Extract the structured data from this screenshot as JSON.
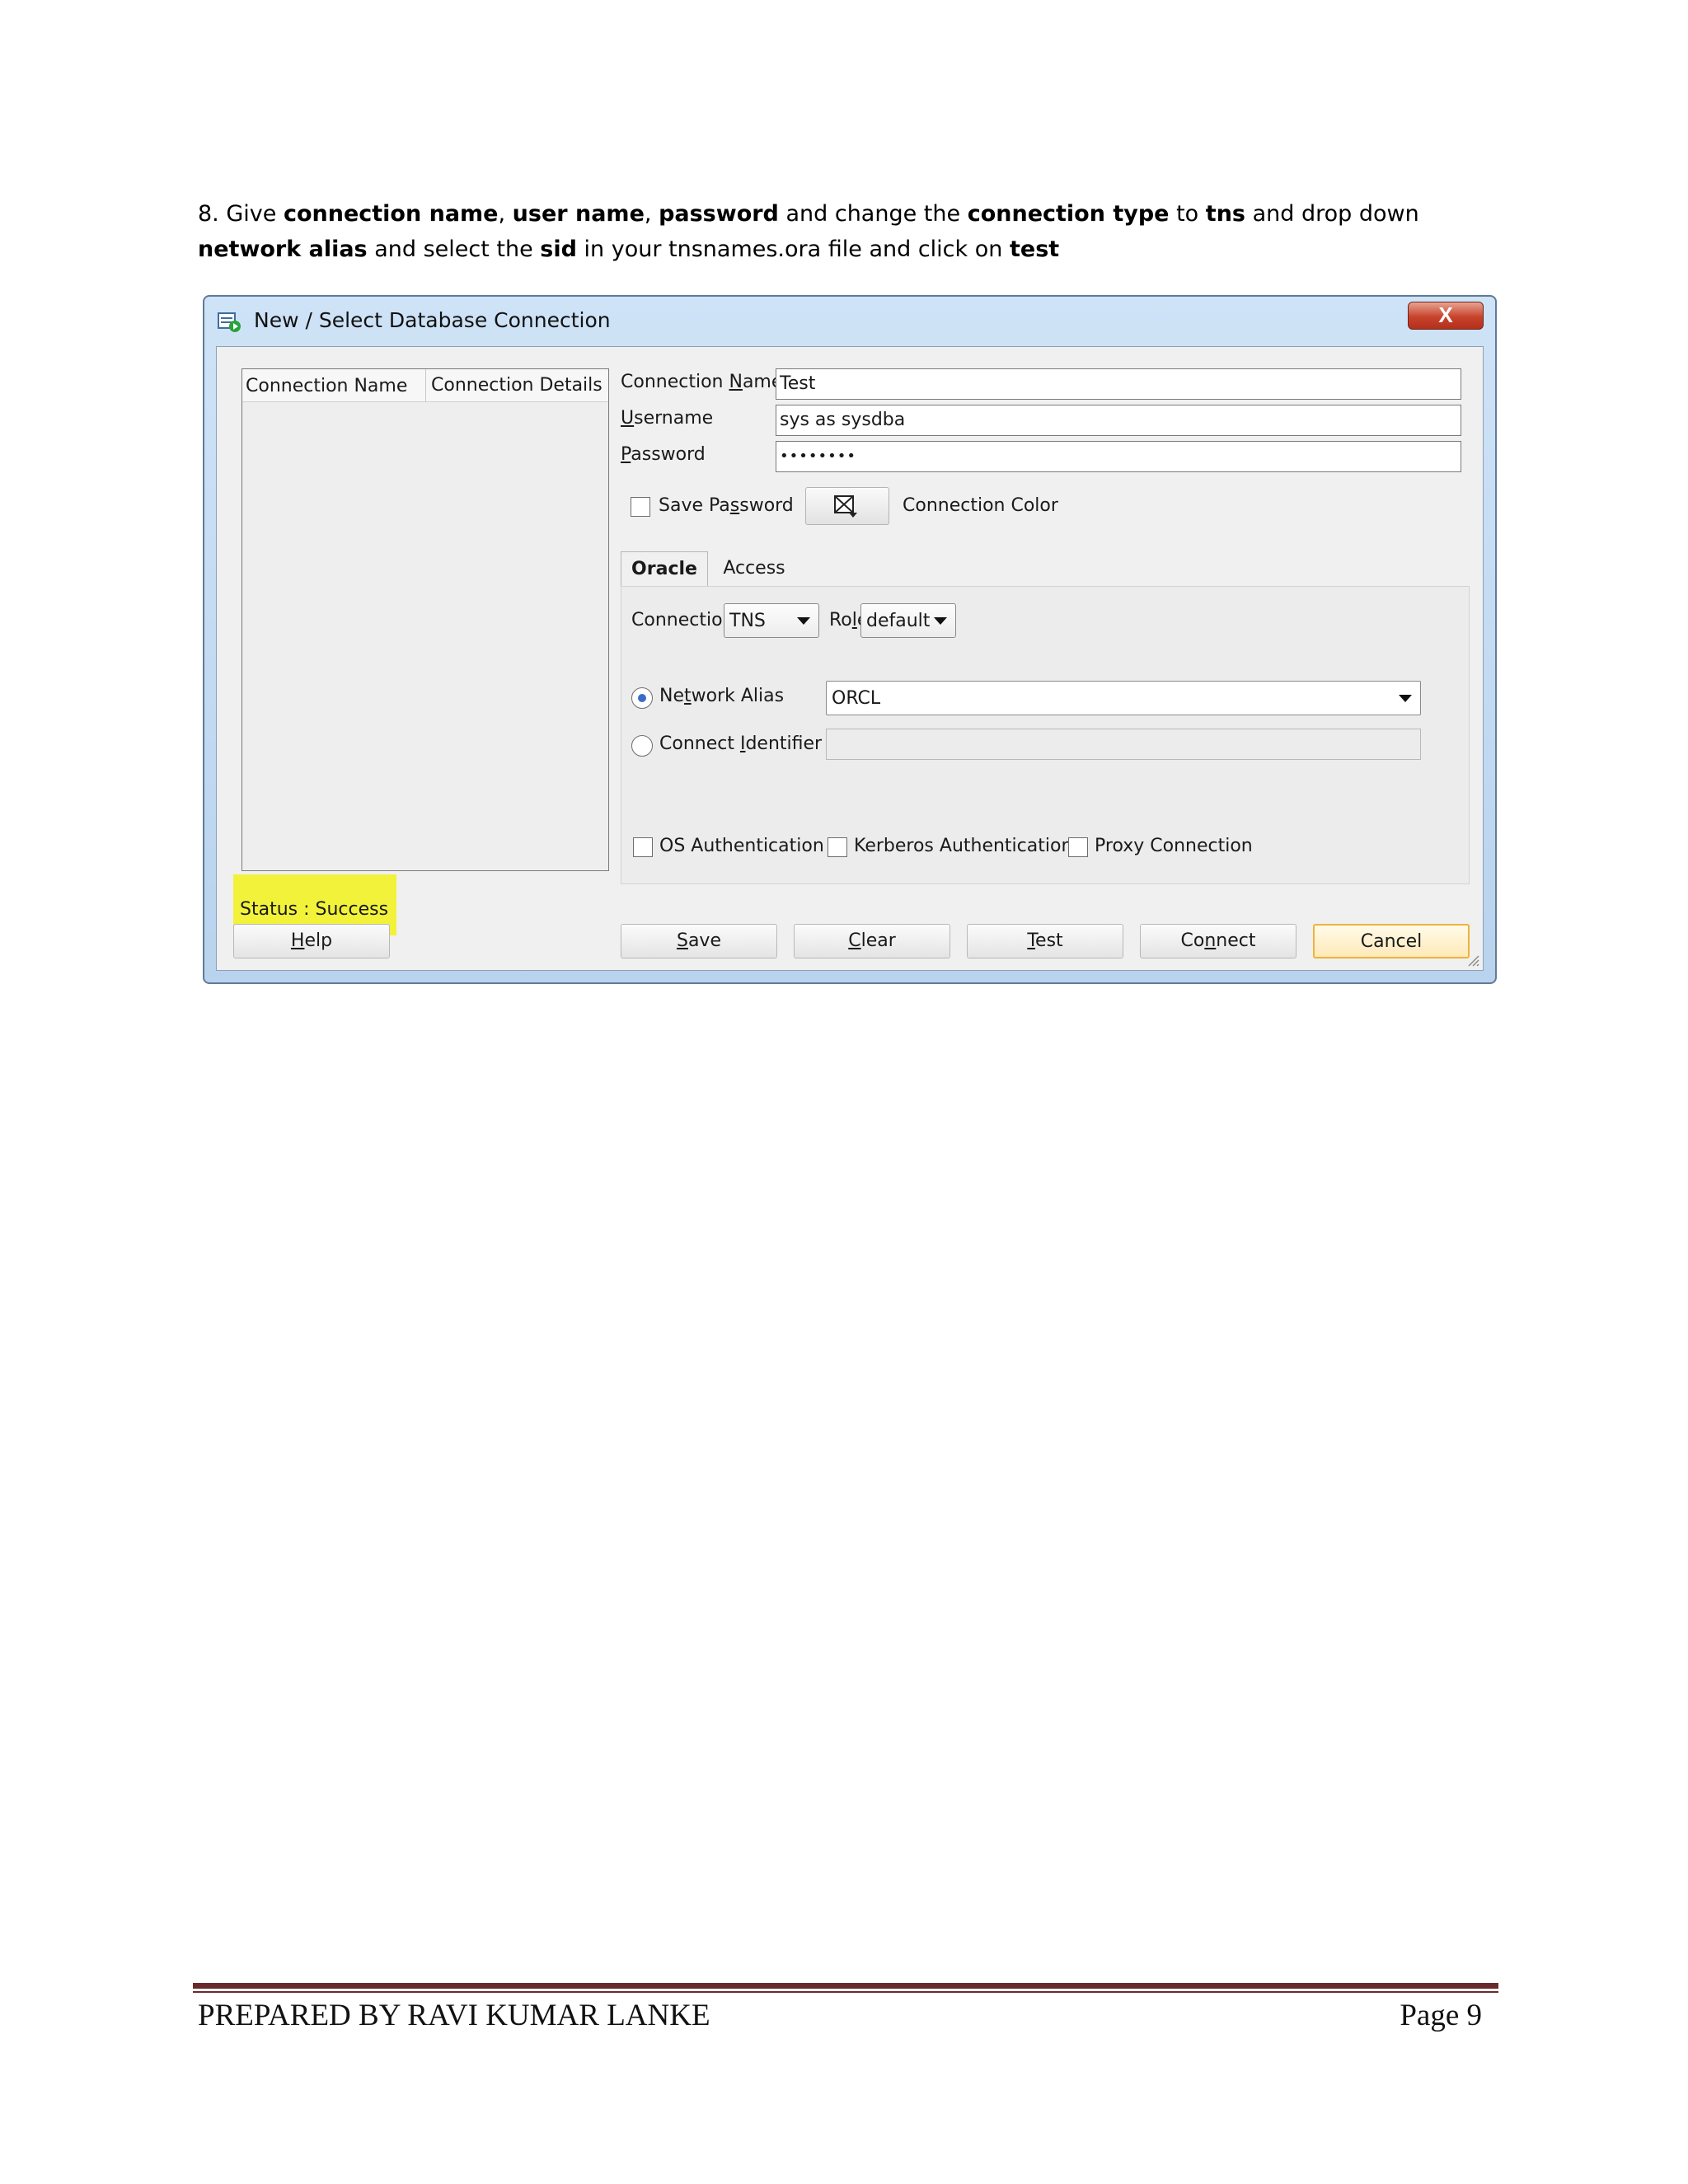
{
  "instruction": {
    "segments": [
      {
        "t": "8. Give ",
        "b": false
      },
      {
        "t": "connection name",
        "b": true
      },
      {
        "t": ", ",
        "b": false
      },
      {
        "t": "user name",
        "b": true
      },
      {
        "t": ", ",
        "b": false
      },
      {
        "t": "password",
        "b": true
      },
      {
        "t": " and change the ",
        "b": false
      },
      {
        "t": "connection type",
        "b": true
      },
      {
        "t": " to ",
        "b": false
      },
      {
        "t": "tns",
        "b": true
      },
      {
        "t": " and drop down ",
        "b": false
      },
      {
        "t": "network alias",
        "b": true
      },
      {
        "t": " and select the ",
        "b": false
      },
      {
        "t": "sid",
        "b": true
      },
      {
        "t": " in your tnsnames.ora file and click on ",
        "b": false
      },
      {
        "t": "test",
        "b": true
      }
    ]
  },
  "dialog": {
    "title": "New / Select Database Connection",
    "close_label": "X",
    "table": {
      "col1": "Connection Name",
      "col2": "Connection Details"
    },
    "status": "Status : Success",
    "fields": {
      "connection_name_label": "Connection Name",
      "connection_name_value": "Test",
      "username_label": "Username",
      "username_value": "sys as sysdba",
      "password_label": "Password",
      "password_value": "••••••••"
    },
    "save_password_label": "Save Password",
    "connection_color_label": "Connection Color",
    "tabs": {
      "oracle": "Oracle",
      "access": "Access"
    },
    "connection_type_label": "Connection Type",
    "connection_type_value": "TNS",
    "role_label": "Role",
    "role_value": "default",
    "network_alias_label": "Network Alias",
    "network_alias_value": "ORCL",
    "connect_identifier_label": "Connect Identifier",
    "os_auth_label": "OS Authentication",
    "kerberos_label": "Kerberos Authentication",
    "proxy_label": "Proxy Connection",
    "buttons": {
      "help": "Help",
      "save": "Save",
      "clear": "Clear",
      "test": "Test",
      "connect": "Connect",
      "cancel": "Cancel"
    },
    "colors": {
      "status_highlight": "#f2f23a",
      "cancel_border": "#f0b23c"
    }
  },
  "footer": {
    "left": "PREPARED BY RAVI KUMAR LANKE",
    "right": "Page 9"
  }
}
